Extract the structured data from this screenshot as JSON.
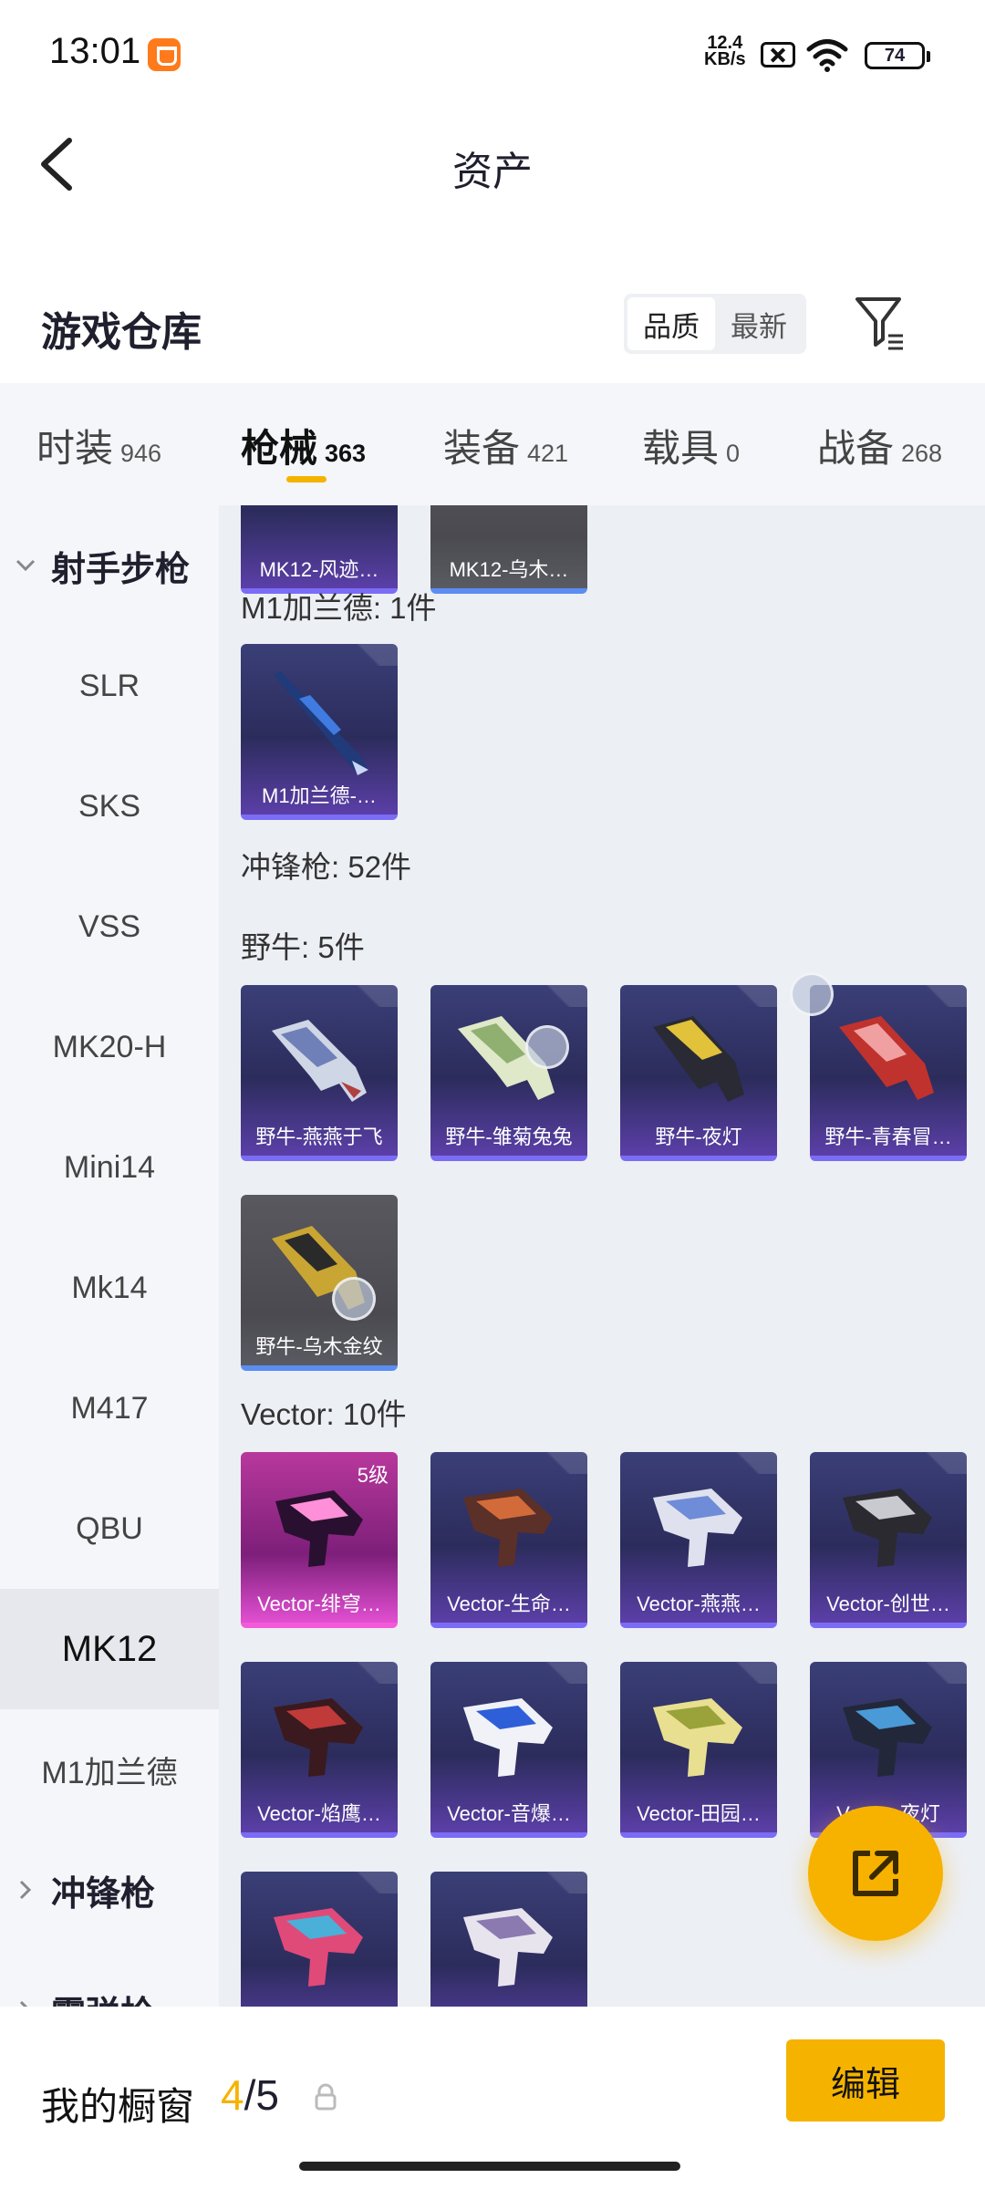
{
  "status": {
    "time": "13:01",
    "net_speed_value": "12.4",
    "net_speed_unit": "KB/s",
    "battery": "74"
  },
  "header": {
    "title": "资产"
  },
  "warehouse": {
    "title": "游戏仓库",
    "sort_quality": "品质",
    "sort_newest": "最新"
  },
  "tabs": [
    {
      "label": "时装",
      "count": "946"
    },
    {
      "label": "枪械",
      "count": "363"
    },
    {
      "label": "装备",
      "count": "421"
    },
    {
      "label": "载具",
      "count": "0"
    },
    {
      "label": "战备",
      "count": "268"
    }
  ],
  "sidebar": {
    "group_rifle": "射手步枪",
    "items": [
      "SLR",
      "SKS",
      "VSS",
      "MK20-H",
      "Mini14",
      "Mk14",
      "M417",
      "QBU",
      "MK12",
      "M1加兰德"
    ],
    "group_smg": "冲锋枪",
    "group_shotgun": "霰弹枪"
  },
  "main": {
    "top_cards": [
      "MK12-风迹…",
      "MK12-乌木…"
    ],
    "m1_section": "M1加兰德: 1件",
    "m1_cards": [
      "M1加兰德-…"
    ],
    "smg_section": "冲锋枪: 52件",
    "bison_section": "野牛: 5件",
    "bison_cards": [
      "野牛-燕燕于飞",
      "野牛-雏菊兔兔",
      "野牛-夜灯",
      "野牛-青春冒…",
      "野牛-乌木金纹"
    ],
    "vector_section": "Vector: 10件",
    "vector_level": "5级",
    "vector_cards": [
      "Vector-绯穹…",
      "Vector-生命…",
      "Vector-燕燕…",
      "Vector-创世…",
      "Vector-焰鹰…",
      "Vector-音爆…",
      "Vector-田园…",
      "Vector-夜灯",
      "",
      ""
    ]
  },
  "showcase": {
    "title": "我的橱窗",
    "current": "4",
    "separator": "/",
    "total": "5",
    "edit_label": "编辑"
  }
}
